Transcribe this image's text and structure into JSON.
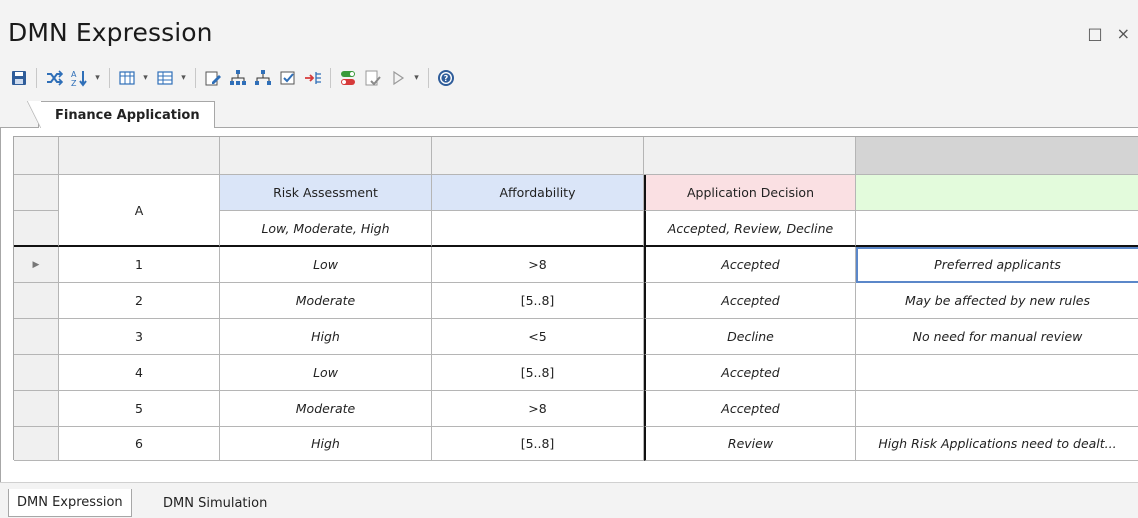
{
  "window": {
    "title": "DMN Expression",
    "maximize_glyph": "□",
    "close_glyph": "×"
  },
  "toolbar": {
    "icons": [
      "save-icon",
      "shuffle-icon",
      "sort-az-icon",
      "table-columns-icon",
      "table-rows-icon",
      "edit-property-icon",
      "hierarchy-icon",
      "hierarchy-alt-icon",
      "edit-check-icon",
      "arrow-into-list-icon",
      "toggle-icon",
      "validate-icon",
      "run-icon",
      "help-icon"
    ],
    "dropdown_glyph": "▾"
  },
  "tab": {
    "label": "Finance Application"
  },
  "table": {
    "hit_policy": "A",
    "inputs": [
      {
        "label": "Risk Assessment",
        "allowed_values": "Low, Moderate, High",
        "color": "#dae5f8"
      },
      {
        "label": "Affordability",
        "allowed_values": "",
        "color": "#dae5f8"
      }
    ],
    "output": {
      "label": "Application Decision",
      "allowed_values": "Accepted, Review, Decline",
      "color": "#fae0e3"
    },
    "annotation": {
      "label": "",
      "allowed_values": "",
      "color": "#e3fbdc"
    },
    "rows": [
      {
        "num": "1",
        "risk": "Low",
        "afford": ">8",
        "decision": "Accepted",
        "annotation": "Preferred applicants"
      },
      {
        "num": "2",
        "risk": "Moderate",
        "afford": "[5..8]",
        "decision": "Accepted",
        "annotation": "May be affected by new rules"
      },
      {
        "num": "3",
        "risk": "High",
        "afford": "<5",
        "decision": "Decline",
        "annotation": "No need for manual review"
      },
      {
        "num": "4",
        "risk": "Low",
        "afford": "[5..8]",
        "decision": "Accepted",
        "annotation": ""
      },
      {
        "num": "5",
        "risk": "Moderate",
        "afford": ">8",
        "decision": "Accepted",
        "annotation": ""
      },
      {
        "num": "6",
        "risk": "High",
        "afford": "[5..8]",
        "decision": "Review",
        "annotation": "High Risk Applications need to dealt..."
      }
    ],
    "current_row_marker": "▶"
  },
  "bottom_tabs": [
    {
      "label": "DMN Expression",
      "active": true
    },
    {
      "label": "DMN Simulation",
      "active": false
    }
  ],
  "colors": {
    "input_header": "#dae5f8",
    "output_header": "#fae0e3",
    "annotation_header": "#e3fbdc",
    "selected_border": "#5b87c9"
  }
}
